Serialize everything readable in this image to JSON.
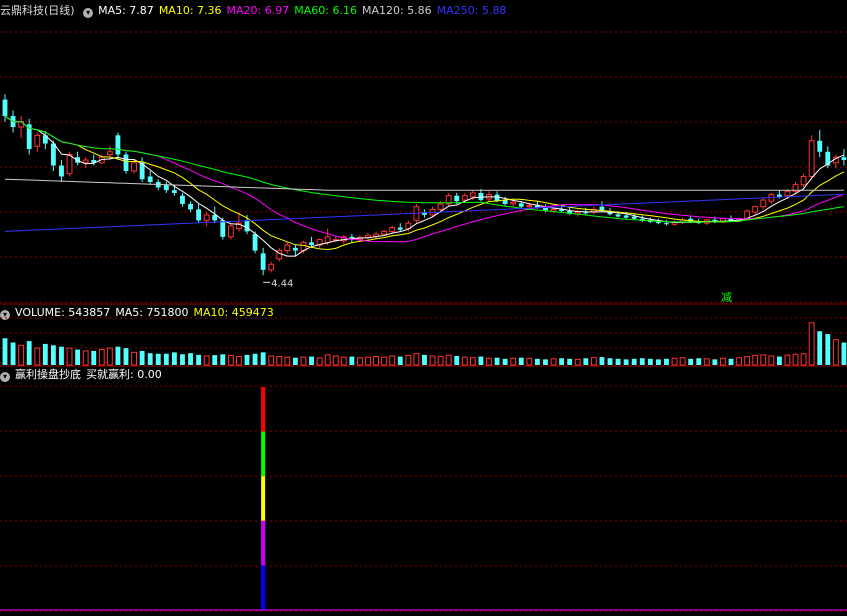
{
  "price_panel": {
    "title": "云鼎科技(日线)",
    "ma_labels": [
      {
        "text": "MA5: 7.87",
        "color": "#ffffff"
      },
      {
        "text": "MA10: 7.36",
        "color": "#ffff00"
      },
      {
        "text": "MA20: 6.97",
        "color": "#ff00ff"
      },
      {
        "text": "MA60: 6.16",
        "color": "#00ff00"
      },
      {
        "text": "MA120: 5.86",
        "color": "#cccccc"
      },
      {
        "text": "MA250: 5.88",
        "color": "#3333ff"
      }
    ],
    "low_annotation": "4.44",
    "signal_label": "减"
  },
  "volume_panel": {
    "labels": [
      {
        "text": "VOLUME: 543857",
        "color": "#ffffff"
      },
      {
        "text": "MA5: 751800",
        "color": "#ffffff"
      },
      {
        "text": "MA10: 459473",
        "color": "#ffff00"
      }
    ]
  },
  "indicator_panel": {
    "labels": [
      {
        "text": "赢利操盘抄底",
        "color": "#ffffff"
      },
      {
        "text": "买就赢利: 0.00",
        "color": "#ffffff"
      }
    ]
  },
  "colors": {
    "up": "#ff3232",
    "down": "#54ffff",
    "grid": "#8b0000",
    "ma5": "#ffffff",
    "ma10": "#ffff00",
    "ma20": "#ff00ff",
    "ma60": "#00ff00",
    "ma120": "#cccccc",
    "ma250": "#3333ff"
  },
  "chart_data": {
    "type": "candlestick",
    "ylim": [
      3.9,
      9.0
    ],
    "ohlc": [
      [
        7.55,
        7.65,
        7.15,
        7.25
      ],
      [
        7.25,
        7.35,
        6.95,
        7.05
      ],
      [
        7.05,
        7.25,
        6.85,
        7.15
      ],
      [
        7.1,
        7.2,
        6.55,
        6.65
      ],
      [
        6.7,
        6.95,
        6.6,
        6.9
      ],
      [
        6.9,
        6.98,
        6.65,
        6.75
      ],
      [
        6.75,
        6.8,
        6.25,
        6.35
      ],
      [
        6.35,
        6.45,
        6.05,
        6.15
      ],
      [
        6.2,
        6.6,
        6.15,
        6.55
      ],
      [
        6.5,
        6.6,
        6.35,
        6.4
      ],
      [
        6.4,
        6.5,
        6.3,
        6.45
      ],
      [
        6.45,
        6.55,
        6.35,
        6.4
      ],
      [
        6.4,
        6.55,
        6.38,
        6.5
      ],
      [
        6.55,
        6.7,
        6.45,
        6.6
      ],
      [
        6.9,
        6.95,
        6.45,
        6.55
      ],
      [
        6.55,
        6.6,
        6.2,
        6.25
      ],
      [
        6.25,
        6.45,
        6.2,
        6.4
      ],
      [
        6.4,
        6.5,
        6.05,
        6.1
      ],
      [
        6.15,
        6.25,
        6.0,
        6.05
      ],
      [
        6.05,
        6.1,
        5.9,
        5.95
      ],
      [
        6.0,
        6.05,
        5.85,
        5.9
      ],
      [
        5.9,
        6.0,
        5.8,
        5.85
      ],
      [
        5.8,
        5.85,
        5.6,
        5.65
      ],
      [
        5.65,
        5.7,
        5.5,
        5.55
      ],
      [
        5.55,
        5.65,
        5.3,
        5.35
      ],
      [
        5.35,
        5.5,
        5.25,
        5.45
      ],
      [
        5.45,
        5.6,
        5.3,
        5.35
      ],
      [
        5.35,
        5.4,
        5.0,
        5.05
      ],
      [
        5.05,
        5.3,
        5.0,
        5.25
      ],
      [
        5.2,
        5.5,
        5.15,
        5.3
      ],
      [
        5.35,
        5.45,
        5.1,
        5.15
      ],
      [
        5.1,
        5.15,
        4.75,
        4.8
      ],
      [
        4.75,
        4.85,
        4.35,
        4.45
      ],
      [
        4.45,
        4.6,
        4.4,
        4.55
      ],
      [
        4.65,
        4.85,
        4.6,
        4.8
      ],
      [
        4.8,
        4.95,
        4.75,
        4.9
      ],
      [
        4.85,
        4.9,
        4.7,
        4.8
      ],
      [
        4.8,
        4.98,
        4.75,
        4.95
      ],
      [
        4.95,
        5.05,
        4.85,
        4.9
      ],
      [
        4.9,
        5.02,
        4.85,
        5.0
      ],
      [
        4.95,
        5.2,
        4.9,
        5.05
      ],
      [
        5.0,
        5.05,
        4.95,
        5.0
      ],
      [
        4.98,
        5.08,
        4.92,
        5.05
      ],
      [
        5.05,
        5.1,
        4.95,
        5.0
      ],
      [
        5.0,
        5.08,
        4.96,
        5.04
      ],
      [
        5.04,
        5.12,
        5.0,
        5.08
      ],
      [
        5.06,
        5.15,
        5.02,
        5.1
      ],
      [
        5.1,
        5.18,
        5.08,
        5.15
      ],
      [
        5.15,
        5.25,
        5.1,
        5.22
      ],
      [
        5.22,
        5.3,
        5.15,
        5.18
      ],
      [
        5.2,
        5.35,
        5.15,
        5.3
      ],
      [
        5.35,
        5.65,
        5.3,
        5.6
      ],
      [
        5.5,
        5.55,
        5.4,
        5.45
      ],
      [
        5.45,
        5.6,
        5.4,
        5.55
      ],
      [
        5.55,
        5.7,
        5.5,
        5.65
      ],
      [
        5.65,
        5.85,
        5.6,
        5.8
      ],
      [
        5.8,
        5.85,
        5.65,
        5.7
      ],
      [
        5.72,
        5.85,
        5.68,
        5.8
      ],
      [
        5.78,
        5.9,
        5.72,
        5.85
      ],
      [
        5.85,
        5.92,
        5.7,
        5.72
      ],
      [
        5.74,
        5.88,
        5.7,
        5.82
      ],
      [
        5.82,
        5.88,
        5.68,
        5.7
      ],
      [
        5.72,
        5.78,
        5.62,
        5.65
      ],
      [
        5.65,
        5.72,
        5.6,
        5.68
      ],
      [
        5.66,
        5.7,
        5.58,
        5.6
      ],
      [
        5.6,
        5.68,
        5.55,
        5.62
      ],
      [
        5.62,
        5.7,
        5.56,
        5.58
      ],
      [
        5.58,
        5.64,
        5.5,
        5.52
      ],
      [
        5.52,
        5.6,
        5.48,
        5.55
      ],
      [
        5.55,
        5.62,
        5.5,
        5.52
      ],
      [
        5.52,
        5.58,
        5.45,
        5.47
      ],
      [
        5.47,
        5.55,
        5.42,
        5.5
      ],
      [
        5.5,
        5.58,
        5.45,
        5.48
      ],
      [
        5.5,
        5.6,
        5.46,
        5.55
      ],
      [
        5.6,
        5.7,
        5.5,
        5.52
      ],
      [
        5.52,
        5.58,
        5.44,
        5.46
      ],
      [
        5.46,
        5.52,
        5.4,
        5.42
      ],
      [
        5.44,
        5.5,
        5.38,
        5.4
      ],
      [
        5.42,
        5.48,
        5.36,
        5.38
      ],
      [
        5.38,
        5.44,
        5.32,
        5.34
      ],
      [
        5.36,
        5.4,
        5.3,
        5.32
      ],
      [
        5.32,
        5.38,
        5.28,
        5.3
      ],
      [
        5.3,
        5.36,
        5.26,
        5.28
      ],
      [
        5.28,
        5.35,
        5.25,
        5.32
      ],
      [
        5.32,
        5.4,
        5.28,
        5.36
      ],
      [
        5.38,
        5.42,
        5.3,
        5.32
      ],
      [
        5.32,
        5.38,
        5.28,
        5.3
      ],
      [
        5.3,
        5.38,
        5.27,
        5.36
      ],
      [
        5.36,
        5.42,
        5.3,
        5.32
      ],
      [
        5.32,
        5.4,
        5.3,
        5.38
      ],
      [
        5.38,
        5.44,
        5.32,
        5.34
      ],
      [
        5.34,
        5.4,
        5.32,
        5.38
      ],
      [
        5.38,
        5.55,
        5.35,
        5.52
      ],
      [
        5.5,
        5.62,
        5.45,
        5.6
      ],
      [
        5.6,
        5.75,
        5.55,
        5.72
      ],
      [
        5.7,
        5.85,
        5.65,
        5.82
      ],
      [
        5.82,
        5.9,
        5.75,
        5.78
      ],
      [
        5.8,
        5.92,
        5.74,
        5.88
      ],
      [
        5.88,
        6.05,
        5.82,
        6.0
      ],
      [
        6.0,
        6.2,
        5.95,
        6.15
      ],
      [
        6.15,
        6.9,
        6.1,
        6.8
      ],
      [
        6.8,
        7.0,
        6.5,
        6.6
      ],
      [
        6.6,
        6.7,
        6.3,
        6.35
      ],
      [
        6.4,
        6.55,
        6.3,
        6.5
      ],
      [
        6.5,
        6.65,
        6.35,
        6.45
      ]
    ],
    "volume": [
      95,
      80,
      70,
      85,
      60,
      75,
      70,
      65,
      60,
      55,
      50,
      50,
      55,
      60,
      65,
      60,
      45,
      50,
      42,
      40,
      40,
      45,
      38,
      42,
      36,
      32,
      35,
      38,
      34,
      30,
      36,
      40,
      45,
      32,
      30,
      28,
      26,
      28,
      30,
      25,
      36,
      32,
      28,
      30,
      26,
      28,
      30,
      28,
      32,
      30,
      34,
      40,
      36,
      32,
      30,
      35,
      32,
      28,
      26,
      30,
      24,
      26,
      22,
      24,
      26,
      24,
      22,
      20,
      22,
      24,
      22,
      20,
      24,
      26,
      28,
      24,
      22,
      20,
      22,
      24,
      22,
      20,
      22,
      24,
      26,
      22,
      24,
      22,
      20,
      24,
      22,
      26,
      30,
      34,
      36,
      32,
      30,
      35,
      38,
      40,
      150,
      120,
      110,
      90,
      80
    ],
    "indicator_signal_index": 32,
    "low_value": 4.44,
    "low_index": 32
  }
}
